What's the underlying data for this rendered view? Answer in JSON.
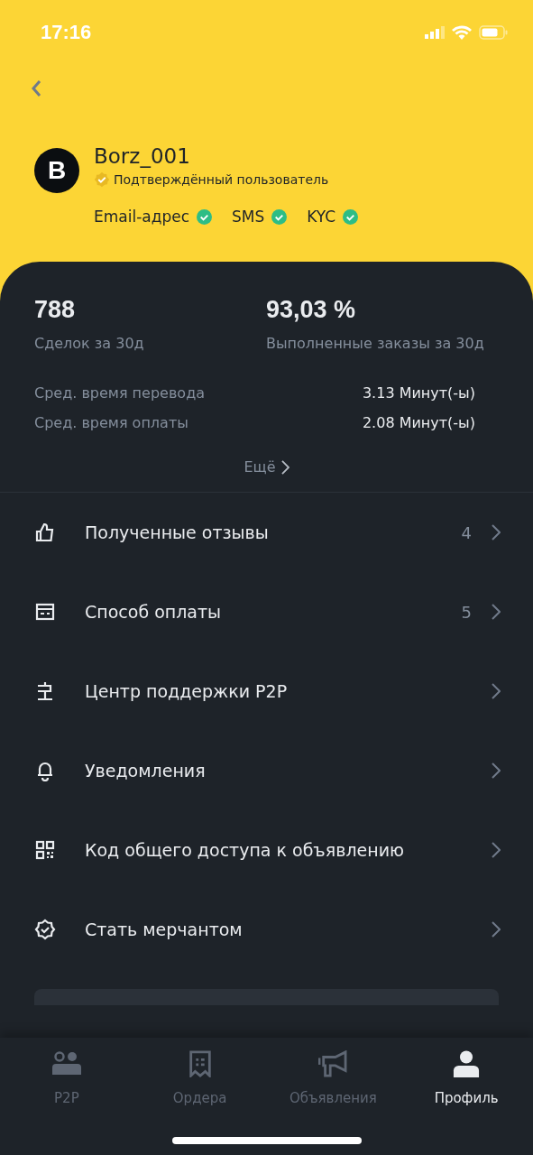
{
  "status_bar": {
    "time": "17:16"
  },
  "profile": {
    "avatar_letter": "B",
    "username": "Borz_001",
    "badge": "Подтверждённый пользователь",
    "verifications": [
      {
        "label": "Email-адрес",
        "verified": true
      },
      {
        "label": "SMS",
        "verified": true
      },
      {
        "label": "KYC",
        "verified": true
      }
    ]
  },
  "stats": [
    {
      "value": "788",
      "label": "Сделок за 30д"
    },
    {
      "value": "93,03 %",
      "label": "Выполненные заказы за 30д"
    }
  ],
  "details": [
    {
      "label": "Сред. время перевода",
      "value": "3.13 Минут(-ы)"
    },
    {
      "label": "Сред. время оплаты",
      "value": "2.08 Минут(-ы)"
    }
  ],
  "more_link": "Ещё",
  "menu": [
    {
      "kind": "thumb",
      "label": "Полученные отзывы",
      "count": "4"
    },
    {
      "kind": "card",
      "label": "Способ оплаты",
      "count": "5"
    },
    {
      "kind": "sign",
      "label": "Центр поддержки P2P"
    },
    {
      "kind": "bell",
      "label": "Уведомления"
    },
    {
      "kind": "qr",
      "label": "Код общего доступа к объявлению"
    },
    {
      "kind": "badge",
      "label": "Стать мерчантом"
    }
  ],
  "tabs": [
    {
      "kind": "people",
      "label": "P2P",
      "selected": false
    },
    {
      "kind": "receipt",
      "label": "Ордера",
      "selected": false
    },
    {
      "kind": "megaphone",
      "label": "Объявления",
      "selected": false
    },
    {
      "kind": "person",
      "label": "Профиль",
      "selected": true
    }
  ]
}
